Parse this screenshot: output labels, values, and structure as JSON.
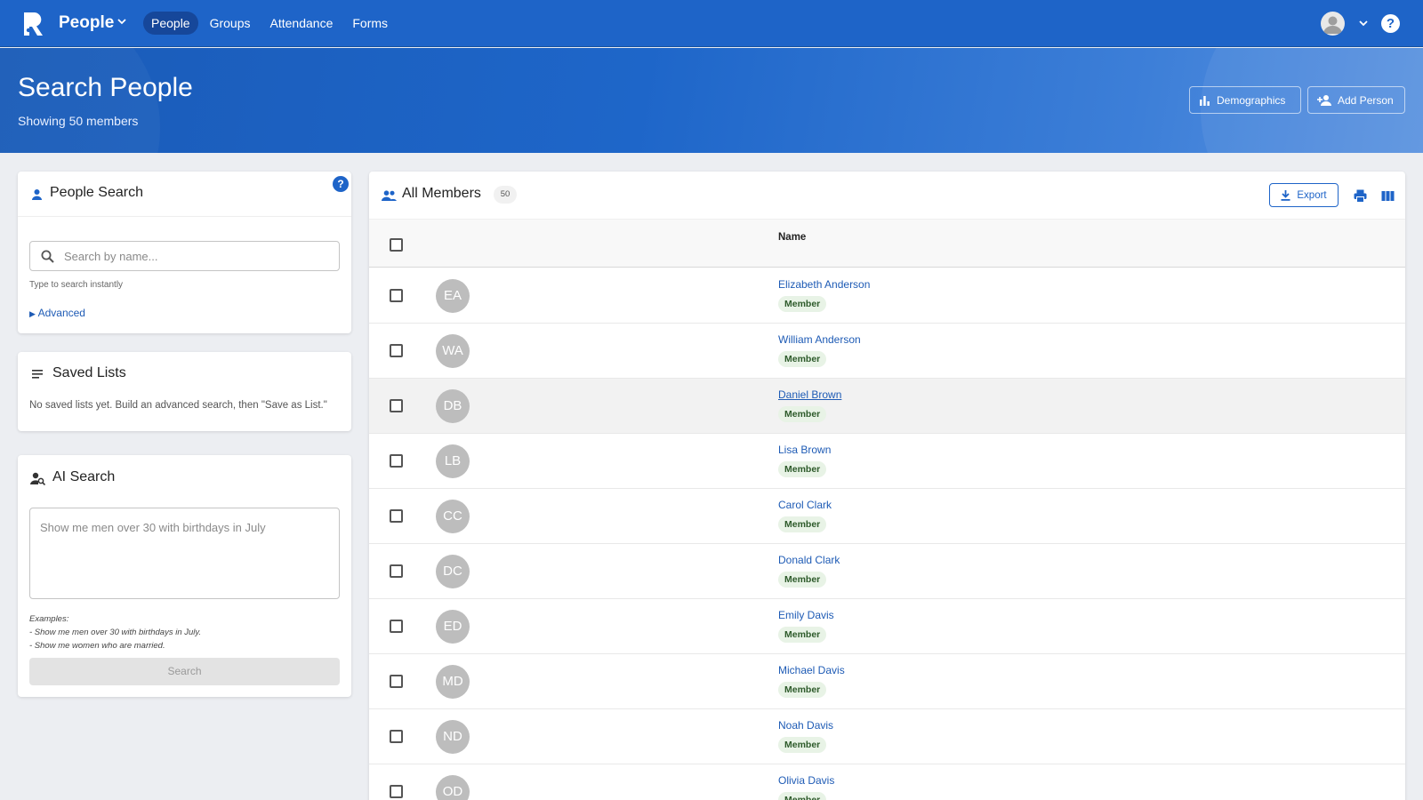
{
  "topbar": {
    "app_name": "People",
    "nav": [
      {
        "label": "People",
        "active": true
      },
      {
        "label": "Groups",
        "active": false
      },
      {
        "label": "Attendance",
        "active": false
      },
      {
        "label": "Forms",
        "active": false
      }
    ]
  },
  "hero": {
    "title": "Search People",
    "subtitle": "Showing 50 members",
    "demographics_label": "Demographics",
    "add_person_label": "Add Person"
  },
  "people_search": {
    "title": "People Search",
    "placeholder": "Search by name...",
    "hint": "Type to search instantly",
    "advanced_label": "Advanced"
  },
  "saved_lists": {
    "title": "Saved Lists",
    "empty_text": "No saved lists yet. Build an advanced search, then \"Save as List.\""
  },
  "ai_search": {
    "title": "AI Search",
    "placeholder": "Show me men over 30 with birthdays in July",
    "examples_heading": "Examples:",
    "example_1": "- Show me men over 30 with birthdays in July.",
    "example_2": "- Show me women who are married.",
    "button_label": "Search"
  },
  "members": {
    "title": "All Members",
    "count": "50",
    "export_label": "Export",
    "column_name": "Name",
    "rows": [
      {
        "initials": "EA",
        "name": "Elizabeth Anderson",
        "role": "Member"
      },
      {
        "initials": "WA",
        "name": "William Anderson",
        "role": "Member"
      },
      {
        "initials": "DB",
        "name": "Daniel Brown",
        "role": "Member"
      },
      {
        "initials": "LB",
        "name": "Lisa Brown",
        "role": "Member"
      },
      {
        "initials": "CC",
        "name": "Carol Clark",
        "role": "Member"
      },
      {
        "initials": "DC",
        "name": "Donald Clark",
        "role": "Member"
      },
      {
        "initials": "ED",
        "name": "Emily Davis",
        "role": "Member"
      },
      {
        "initials": "MD",
        "name": "Michael Davis",
        "role": "Member"
      },
      {
        "initials": "ND",
        "name": "Noah Davis",
        "role": "Member"
      },
      {
        "initials": "OD",
        "name": "Olivia Davis",
        "role": "Member"
      }
    ]
  },
  "colors": {
    "primary": "#1e64c8",
    "link": "#1e5bb5",
    "badge_bg": "#e8f3e6",
    "avatar_bg": "#bdbdbd"
  }
}
